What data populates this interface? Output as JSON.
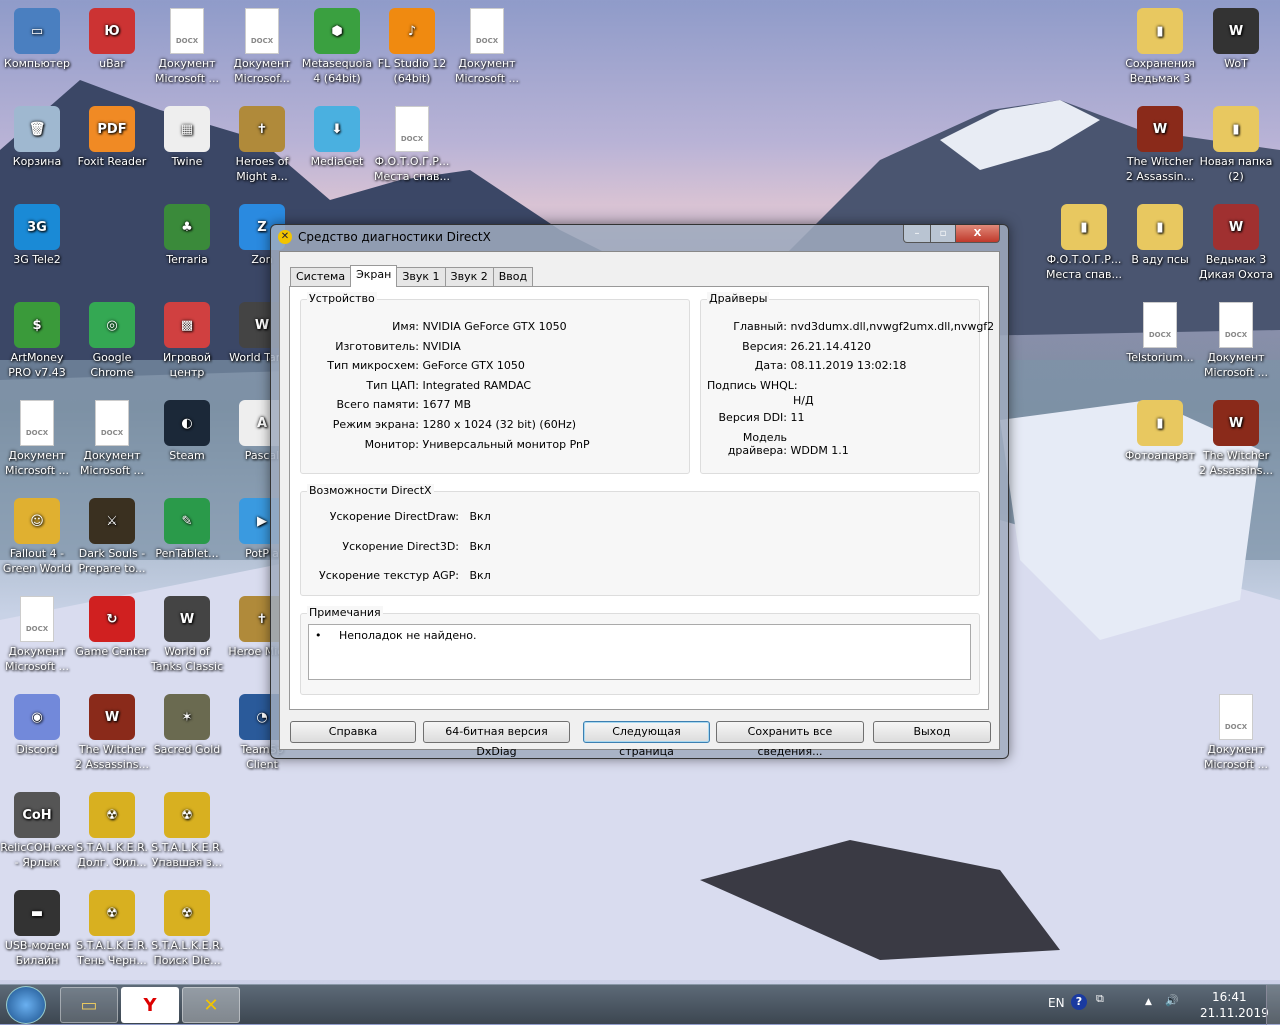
{
  "desktop": {
    "icons_left": [
      {
        "label": "Компьютер",
        "col": 0,
        "row": 0,
        "color": "#4a7fc0",
        "glyph": "▭"
      },
      {
        "label": "Корзина",
        "col": 0,
        "row": 1,
        "color": "#9fb8d0",
        "glyph": "🗑"
      },
      {
        "label": "3G Tele2",
        "col": 0,
        "row": 2,
        "color": "#1a8ad6",
        "glyph": "3G"
      },
      {
        "label": "ArtMoney PRO v7.43",
        "col": 0,
        "row": 3,
        "color": "#3a9a3a",
        "glyph": "$"
      },
      {
        "label": "Документ Microsoft ...",
        "col": 0,
        "row": 4,
        "doc": true
      },
      {
        "label": "Fallout 4 - Green World",
        "col": 0,
        "row": 5,
        "color": "#e0b030",
        "glyph": "☺"
      },
      {
        "label": "Документ Microsoft ...",
        "col": 0,
        "row": 6,
        "doc": true
      },
      {
        "label": "Discord",
        "col": 0,
        "row": 7,
        "color": "#7289da",
        "glyph": "◉"
      },
      {
        "label": "RelicCOH.exe - Ярлык",
        "col": 0,
        "row": 8,
        "color": "#555",
        "glyph": "CoH"
      },
      {
        "label": "USB-модем Билайн",
        "col": 0,
        "row": 9,
        "color": "#333",
        "glyph": "▬"
      },
      {
        "label": "uBar",
        "col": 1,
        "row": 0,
        "color": "#c33",
        "glyph": "Ю"
      },
      {
        "label": "Foxit Reader",
        "col": 1,
        "row": 1,
        "color": "#f08a24",
        "glyph": "PDF"
      },
      {
        "label": "Google Chrome",
        "col": 1,
        "row": 3,
        "color": "#34a853",
        "glyph": "◎"
      },
      {
        "label": "Документ Microsoft ...",
        "col": 1,
        "row": 4,
        "doc": true
      },
      {
        "label": "Dark Souls - Prepare to...",
        "col": 1,
        "row": 5,
        "color": "#3a3020",
        "glyph": "⚔"
      },
      {
        "label": "Game Center",
        "col": 1,
        "row": 6,
        "color": "#d02020",
        "glyph": "↻"
      },
      {
        "label": "The Witcher 2 Assassins...",
        "col": 1,
        "row": 7,
        "color": "#8a2a1a",
        "glyph": "W"
      },
      {
        "label": "S.T.A.L.K.E.R. Долг. Фил...",
        "col": 1,
        "row": 8,
        "color": "#d8b020",
        "glyph": "☢"
      },
      {
        "label": "S.T.A.L.K.E.R. Тень Черн...",
        "col": 1,
        "row": 9,
        "color": "#d8b020",
        "glyph": "☢"
      },
      {
        "label": "Документ Microsoft ...",
        "col": 2,
        "row": 0,
        "doc": true
      },
      {
        "label": "Twine",
        "col": 2,
        "row": 1,
        "color": "#eee",
        "glyph": "▦"
      },
      {
        "label": "Terraria",
        "col": 2,
        "row": 2,
        "color": "#3a8a3a",
        "glyph": "♣"
      },
      {
        "label": "Игровой центр",
        "col": 2,
        "row": 3,
        "color": "#d04040",
        "glyph": "▩"
      },
      {
        "label": "Steam",
        "col": 2,
        "row": 4,
        "color": "#1b2838",
        "glyph": "◐"
      },
      {
        "label": "PenTablet...",
        "col": 2,
        "row": 5,
        "color": "#2a9a4a",
        "glyph": "✎"
      },
      {
        "label": "World of Tanks Classic",
        "col": 2,
        "row": 6,
        "color": "#444",
        "glyph": "W"
      },
      {
        "label": "Sacred Gold",
        "col": 2,
        "row": 7,
        "color": "#6a6a50",
        "glyph": "✶"
      },
      {
        "label": "S.T.A.L.K.E.R. Упавшая з...",
        "col": 2,
        "row": 8,
        "color": "#d8b020",
        "glyph": "☢"
      },
      {
        "label": "S.T.A.L.K.E.R. Поиск Dle...",
        "col": 2,
        "row": 9,
        "color": "#d8b020",
        "glyph": "☢"
      },
      {
        "label": "Документ Microsof...",
        "col": 3,
        "row": 0,
        "doc": true
      },
      {
        "label": "Heroes of Might a...",
        "col": 3,
        "row": 1,
        "color": "#b08a3a",
        "glyph": "✝"
      },
      {
        "label": "Zon",
        "col": 3,
        "row": 2,
        "color": "#2a8ae0",
        "glyph": "Z"
      },
      {
        "label": "World Tanks",
        "col": 3,
        "row": 3,
        "color": "#444",
        "glyph": "W"
      },
      {
        "label": "Pascal",
        "col": 3,
        "row": 4,
        "color": "#eee",
        "glyph": "A"
      },
      {
        "label": "PotPla",
        "col": 3,
        "row": 5,
        "color": "#3a9ae0",
        "glyph": "▶"
      },
      {
        "label": "Heroe Might",
        "col": 3,
        "row": 6,
        "color": "#b08a3a",
        "glyph": "✝"
      },
      {
        "label": "TeamSp Client",
        "col": 3,
        "row": 7,
        "color": "#2a5a9a",
        "glyph": "◔"
      },
      {
        "label": "Metasequoia 4 (64bit)",
        "col": 4,
        "row": 0,
        "color": "#3aa040",
        "glyph": "⬢"
      },
      {
        "label": "MediaGet",
        "col": 4,
        "row": 1,
        "color": "#4ab0e0",
        "glyph": "⬇"
      },
      {
        "label": "FL Studio 12 (64bit)",
        "col": 5,
        "row": 0,
        "color": "#f08a10",
        "glyph": "♪"
      },
      {
        "label": "Ф.О.Т.О.Г.Р... Места спав...",
        "col": 5,
        "row": 1,
        "doc": true
      },
      {
        "label": "Документ Microsoft ...",
        "col": 6,
        "row": 0,
        "doc": true
      }
    ],
    "icons_right": [
      {
        "label": "Сохранения Ведьмак 3",
        "col": 1,
        "row": 0,
        "color": "#e8c860",
        "glyph": "▮"
      },
      {
        "label": "WoT",
        "col": 0,
        "row": 0,
        "color": "#333",
        "glyph": "W"
      },
      {
        "label": "The Witcher 2 Assassin...",
        "col": 1,
        "row": 1,
        "color": "#8a2a1a",
        "glyph": "W"
      },
      {
        "label": "Новая папка (2)",
        "col": 0,
        "row": 1,
        "color": "#e8c860",
        "glyph": "▮"
      },
      {
        "label": "Ф.О.Т.О.Г.Р... Места спав...",
        "col": 2,
        "row": 2,
        "color": "#e8c860",
        "glyph": "▮"
      },
      {
        "label": "В аду псы",
        "col": 1,
        "row": 2,
        "color": "#e8c860",
        "glyph": "▮"
      },
      {
        "label": "Ведьмак 3 Дикая Охота",
        "col": 0,
        "row": 2,
        "color": "#a03030",
        "glyph": "W"
      },
      {
        "label": "Telstorium...",
        "col": 1,
        "row": 3,
        "doc": true
      },
      {
        "label": "Документ Microsoft ...",
        "col": 0,
        "row": 3,
        "doc": true
      },
      {
        "label": "Фотоапарат",
        "col": 1,
        "row": 4,
        "color": "#e8c860",
        "glyph": "▮"
      },
      {
        "label": "The Witcher 2 Assassins...",
        "col": 0,
        "row": 4,
        "color": "#8a2a1a",
        "glyph": "W"
      },
      {
        "label": "Документ Microsoft ...",
        "col": 0,
        "row": 7,
        "doc": true
      }
    ],
    "doc_badge": "DOCX"
  },
  "window": {
    "title": "Средство диагностики DirectX",
    "close": "X",
    "tabs": [
      {
        "label": "Система"
      },
      {
        "label": "Экран",
        "active": true
      },
      {
        "label": "Звук 1"
      },
      {
        "label": "Звук 2"
      },
      {
        "label": "Ввод"
      }
    ],
    "device": {
      "label": "Устройство",
      "rows": [
        {
          "k": "Имя:",
          "v": "NVIDIA GeForce GTX 1050"
        },
        {
          "k": "Изготовитель:",
          "v": "NVIDIA"
        },
        {
          "k": "Тип микросхем:",
          "v": "GeForce GTX 1050"
        },
        {
          "k": "Тип ЦАП:",
          "v": "Integrated RAMDAC"
        },
        {
          "k": "Всего памяти:",
          "v": "1677 MB"
        },
        {
          "k": "Режим экрана:",
          "v": "1280 x 1024 (32 bit) (60Hz)"
        },
        {
          "k": "Монитор:",
          "v": "Универсальный монитор PnP"
        }
      ]
    },
    "drivers": {
      "label": "Драйверы",
      "main_k": "Главный:",
      "main_v": "nvd3dumx.dll,nvwgf2umx.dll,nvwgf2",
      "ver_k": "Версия:",
      "ver_v": "26.21.14.4120",
      "date_k": "Дата:",
      "date_v": "08.11.2019 13:02:18",
      "whql_k": "Подпись WHQL:",
      "whql_v": "Н/Д",
      "ddi_k": "Версия DDI:",
      "ddi_v": "11",
      "model_k1": "Модель",
      "model_k2": "драйвера:",
      "model_v": "WDDM 1.1"
    },
    "directx": {
      "label": "Возможности DirectX",
      "rows": [
        {
          "k": "Ускорение DirectDraw:",
          "v": "Вкл"
        },
        {
          "k": "Ускорение Direct3D:",
          "v": "Вкл"
        },
        {
          "k": "Ускорение текстур AGP:",
          "v": "Вкл"
        }
      ]
    },
    "notes": {
      "label": "Примечания",
      "text": "Неполадок не найдено."
    },
    "buttons": {
      "help": "Справка",
      "dxdiag64": "64-битная версия DxDiag",
      "next": "Следующая страница",
      "save": "Сохранить все сведения...",
      "exit": "Выход"
    }
  },
  "taskbar": {
    "lang": "EN",
    "time": "16:41",
    "date": "21.11.2019"
  }
}
